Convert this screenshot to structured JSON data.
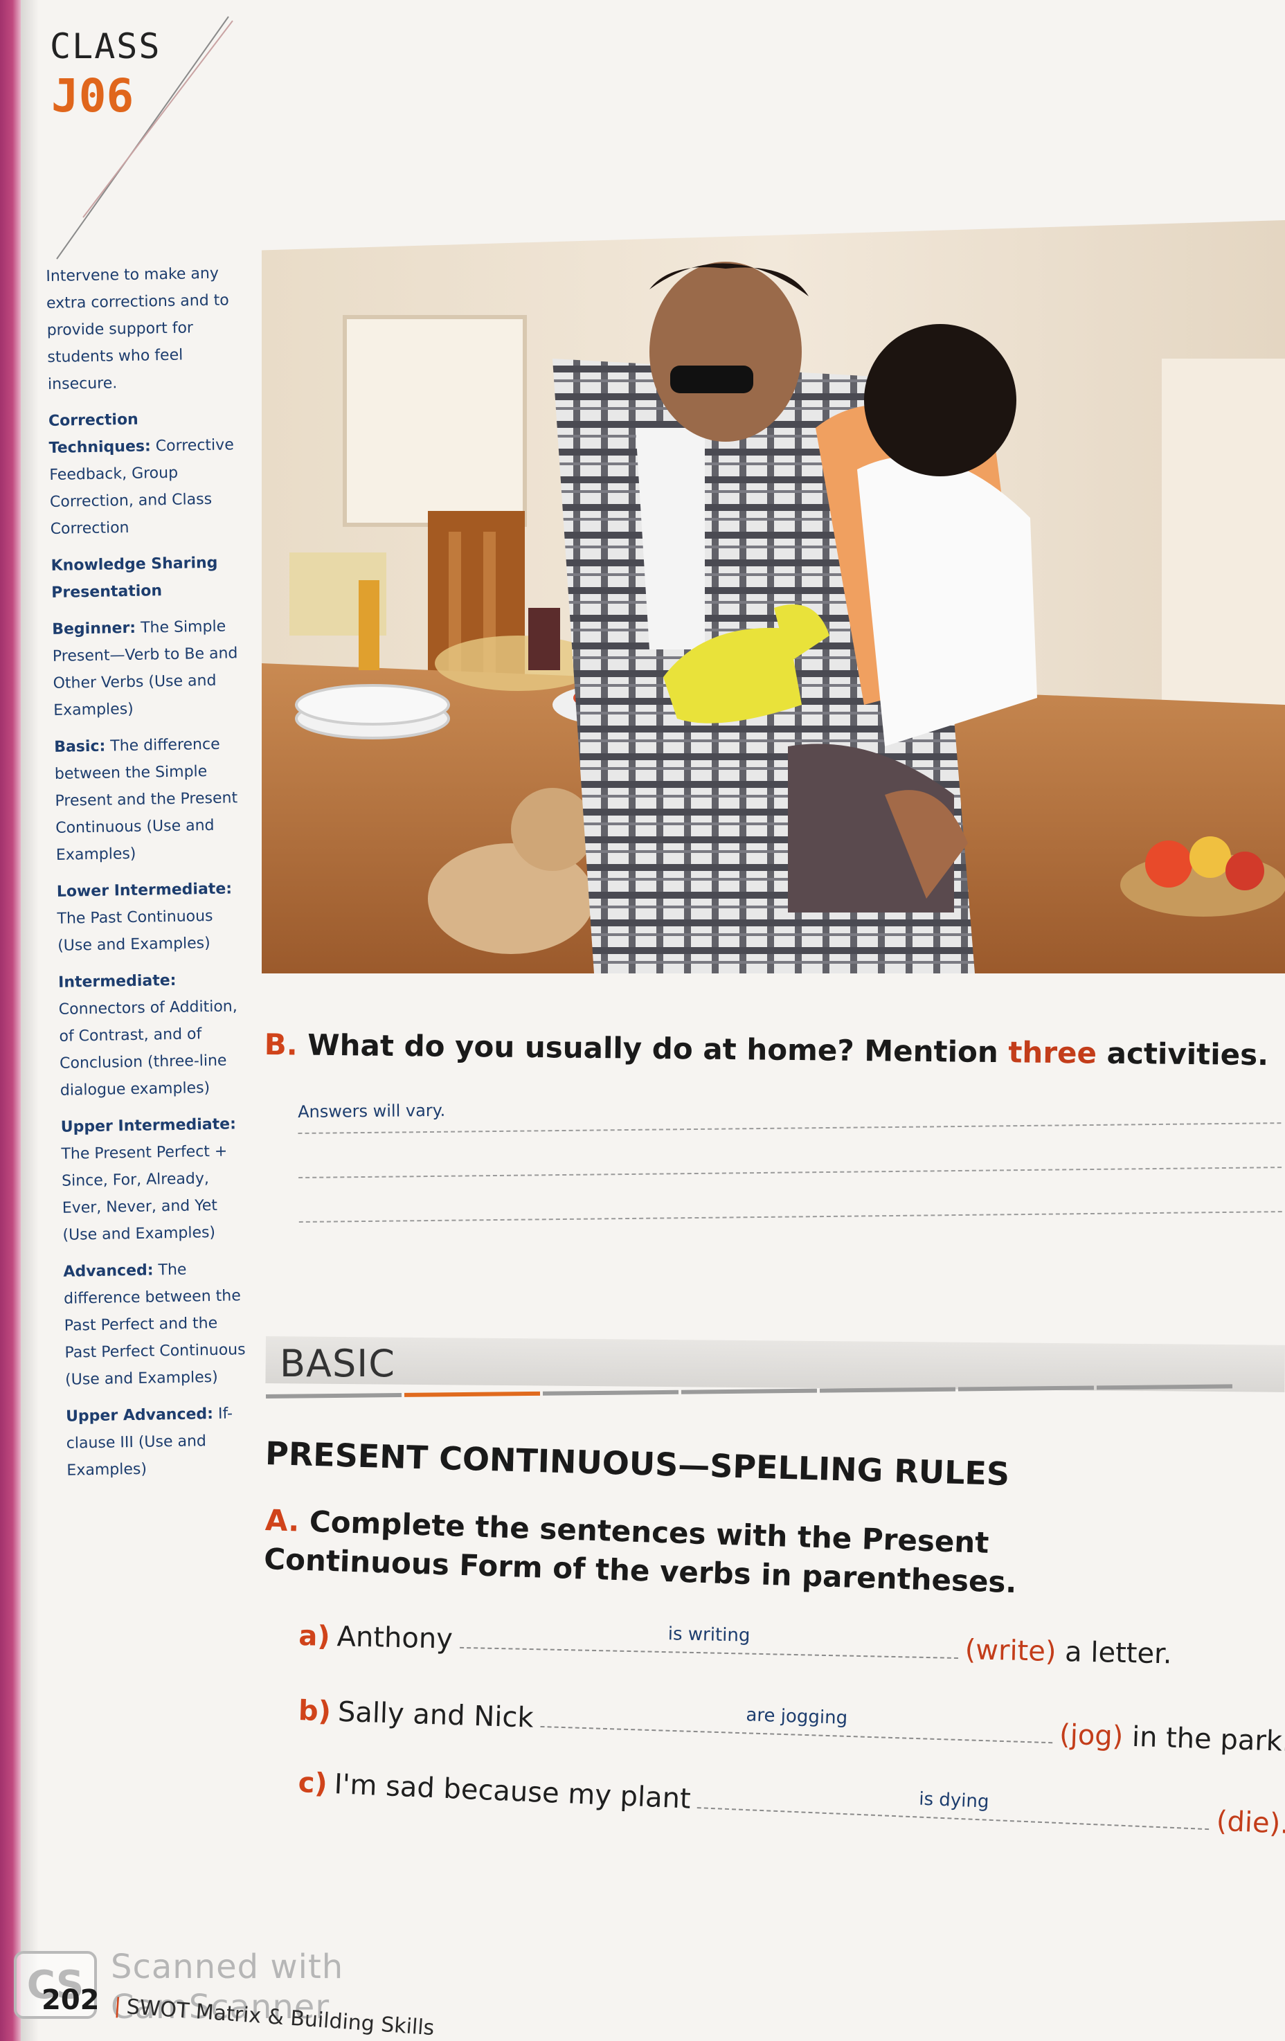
{
  "header": {
    "class_label": "CLASS",
    "class_number": "J06"
  },
  "sidebar": [
    {
      "head": "",
      "text": "Intervene to make any extra corrections and to provide support for students who feel insecure."
    },
    {
      "head": "Correction Techniques:",
      "text": "Corrective Feedback, Group Correction, and Class Correction"
    },
    {
      "head": "Knowledge Sharing Presentation",
      "text": ""
    },
    {
      "head": "Beginner:",
      "text": "The Simple Present—Verb to Be and Other Verbs (Use and Examples)"
    },
    {
      "head": "Basic:",
      "text": "The difference between the Simple Present and the Present Continuous (Use and Examples)"
    },
    {
      "head": "Lower Intermediate:",
      "text": "The Past Continuous (Use and Examples)"
    },
    {
      "head": "Intermediate:",
      "text": "Connectors of Addition, of Contrast, and of Conclusion (three-line dialogue examples)"
    },
    {
      "head": "Upper Intermediate:",
      "text": "The Present Perfect + Since, For, Already, Ever, Never, and Yet (Use and Examples)"
    },
    {
      "head": "Advanced:",
      "text": "The difference between the Past Perfect and the Past Perfect Continuous (Use and Examples)"
    },
    {
      "head": "Upper Advanced:",
      "text": "If-clause III (Use and Examples)"
    }
  ],
  "question_b": {
    "letter": "B.",
    "text_before": "What do you usually do at home? Mention",
    "accent": "three",
    "text_after": "activities.",
    "answer_note": "Answers will vary."
  },
  "level_banner": "BASIC",
  "section_title": "PRESENT CONTINUOUS—SPELLING RULES",
  "question_a": {
    "letter": "A.",
    "text": "Complete the sentences with the Present Continuous Form of the verbs in parentheses."
  },
  "exercises": [
    {
      "label": "a)",
      "before": "Anthony",
      "answer": "is writing",
      "verb": "(write)",
      "after": "a letter."
    },
    {
      "label": "b)",
      "before": "Sally and Nick",
      "answer": "are jogging",
      "verb": "(jog)",
      "after": "in the park."
    },
    {
      "label": "c)",
      "before": "I'm sad because my plant",
      "answer": "is dying",
      "verb": "(die).",
      "after": ""
    }
  ],
  "footer": {
    "page_number": "202",
    "book_title": "SWOT Matrix & Building Skills",
    "scanner_logo": "CS",
    "scanner_line1": "Scanned with",
    "scanner_line2": "CamScanner"
  },
  "colors": {
    "accent_orange": "#d0431a",
    "note_blue": "#1d3d6e",
    "spine_magenta": "#b03a74"
  }
}
